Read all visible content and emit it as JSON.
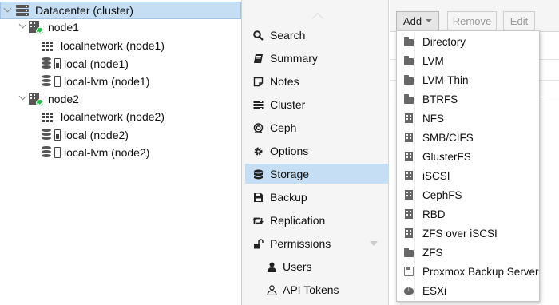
{
  "tree": {
    "datacenter": "Datacenter (cluster)",
    "nodes": [
      {
        "label": "node1",
        "children": [
          "localnetwork (node1)",
          "local (node1)",
          "local-lvm (node1)"
        ]
      },
      {
        "label": "node2",
        "children": [
          "localnetwork (node2)",
          "local (node2)",
          "local-lvm (node2)"
        ]
      }
    ]
  },
  "menu": {
    "items": [
      {
        "label": "Search",
        "icon": "search-icon"
      },
      {
        "label": "Summary",
        "icon": "book-icon"
      },
      {
        "label": "Notes",
        "icon": "sticky-note-icon"
      },
      {
        "label": "Cluster",
        "icon": "server-icon"
      },
      {
        "label": "Ceph",
        "icon": "ceph-icon"
      },
      {
        "label": "Options",
        "icon": "gear-icon"
      },
      {
        "label": "Storage",
        "icon": "database-icon",
        "active": true
      },
      {
        "label": "Backup",
        "icon": "floppy-icon"
      },
      {
        "label": "Replication",
        "icon": "retweet-icon"
      },
      {
        "label": "Permissions",
        "icon": "unlock-icon"
      },
      {
        "label": "Users",
        "icon": "user-icon"
      },
      {
        "label": "API Tokens",
        "icon": "user-outline-icon"
      }
    ]
  },
  "toolbar": {
    "add_label": "Add",
    "remove_label": "Remove",
    "edit_label": "Edit"
  },
  "dropdown": {
    "items": [
      {
        "label": "Directory",
        "icon": "folder-icon"
      },
      {
        "label": "LVM",
        "icon": "folder-icon"
      },
      {
        "label": "LVM-Thin",
        "icon": "folder-icon"
      },
      {
        "label": "BTRFS",
        "icon": "folder-icon"
      },
      {
        "label": "NFS",
        "icon": "building-icon"
      },
      {
        "label": "SMB/CIFS",
        "icon": "building-icon"
      },
      {
        "label": "GlusterFS",
        "icon": "building-icon"
      },
      {
        "label": "iSCSI",
        "icon": "building-icon"
      },
      {
        "label": "CephFS",
        "icon": "building-icon"
      },
      {
        "label": "RBD",
        "icon": "building-icon"
      },
      {
        "label": "ZFS over iSCSI",
        "icon": "building-icon"
      },
      {
        "label": "ZFS",
        "icon": "folder-icon"
      },
      {
        "label": "Proxmox Backup Server",
        "icon": "floppy-icon"
      },
      {
        "label": "ESXi",
        "icon": "cloud-download-icon"
      }
    ]
  },
  "colors": {
    "selection": "#c6def3",
    "status_ok": "#21bf4b"
  }
}
